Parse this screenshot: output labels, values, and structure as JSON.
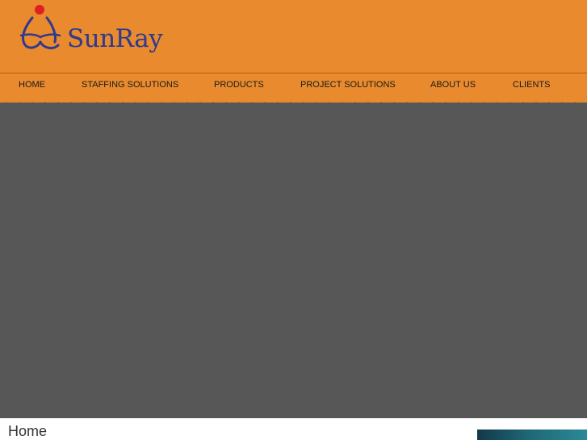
{
  "brand": {
    "name": "SunRay",
    "colors": {
      "header": "#e88a2d",
      "hero": "#575757",
      "text_primary": "#2e3a8c",
      "accent_dot": "#e02020"
    }
  },
  "nav": {
    "items": [
      {
        "label": "HOME"
      },
      {
        "label": "STAFFING SOLUTIONS"
      },
      {
        "label": "PRODUCTS"
      },
      {
        "label": "PROJECT SOLUTIONS"
      },
      {
        "label": "ABOUT US"
      },
      {
        "label": "CLIENTS"
      }
    ]
  },
  "page": {
    "heading": "Home"
  }
}
